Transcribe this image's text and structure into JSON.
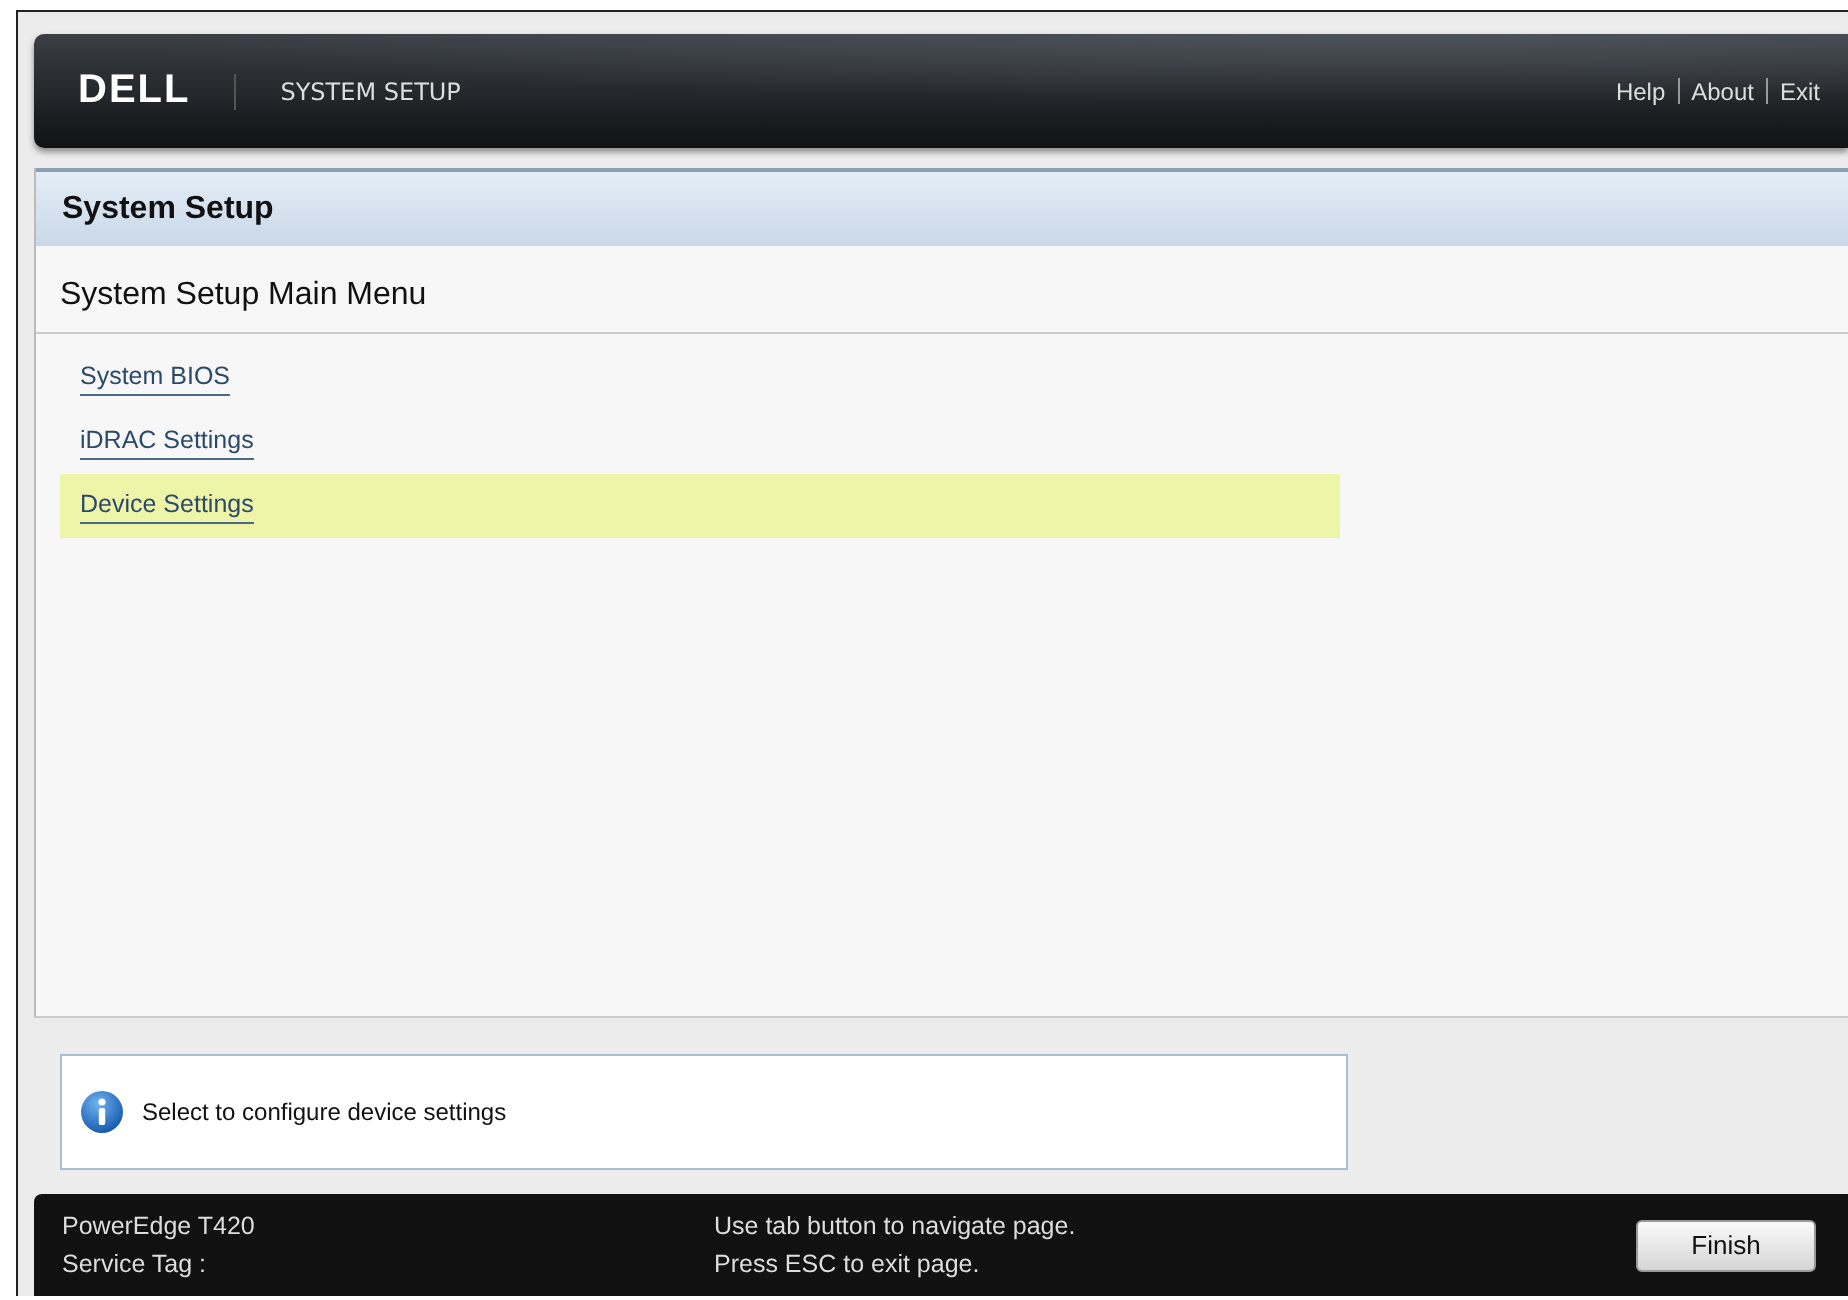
{
  "header": {
    "logo": "DELL",
    "title": "SYSTEM SETUP",
    "links": [
      "Help",
      "About",
      "Exit"
    ]
  },
  "panel": {
    "title": "System Setup",
    "heading": "System Setup Main Menu",
    "items": [
      {
        "label": "System BIOS",
        "selected": false
      },
      {
        "label": "iDRAC Settings",
        "selected": false
      },
      {
        "label": "Device Settings",
        "selected": true
      }
    ]
  },
  "help": {
    "text": "Select to configure device settings"
  },
  "footer": {
    "model": "PowerEdge T420",
    "service_tag": "Service Tag :",
    "hints": [
      "Use tab button to navigate page.",
      "Press ESC to exit page."
    ],
    "button": "Finish"
  }
}
